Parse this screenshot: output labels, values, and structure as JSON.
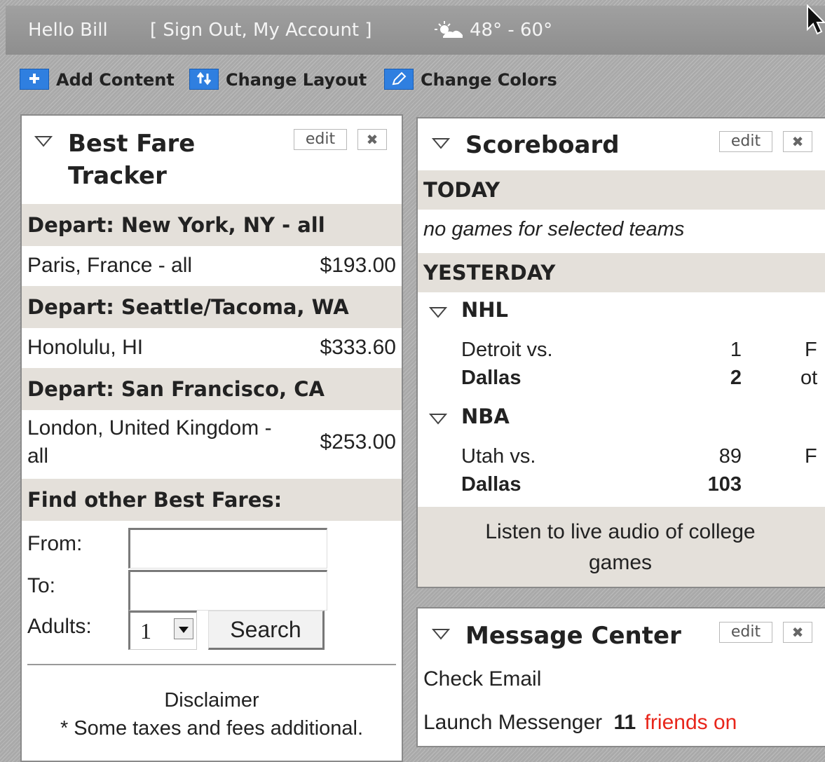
{
  "topbar": {
    "greeting": "Hello Bill",
    "account_links": "[ Sign Out, My Account ]",
    "weather": "48° - 60°"
  },
  "toolbar": {
    "add_content": "Add Content",
    "change_layout": "Change Layout",
    "change_colors": "Change Colors"
  },
  "fare_tracker": {
    "title_line1": "Best Fare",
    "title_line2": "Tracker",
    "edit_label": "edit",
    "close_label": "✖",
    "groups": [
      {
        "depart": "Depart: New York, NY - all",
        "dest": "Paris, France - all",
        "price": "$193.00"
      },
      {
        "depart": "Depart: Seattle/Tacoma, WA",
        "dest": "Honolulu, HI",
        "price": "$333.60"
      },
      {
        "depart": "Depart: San Francisco, CA",
        "dest_line1": "London, United Kingdom -",
        "dest_line2": "all",
        "price": "$253.00"
      }
    ],
    "find_heading": "Find other Best Fares:",
    "from_label": "From:",
    "to_label": "To:",
    "adults_label": "Adults:",
    "from_value": "",
    "to_value": "",
    "adults_value": "1",
    "search_label": "Search",
    "disclaimer_title": "Disclaimer",
    "disclaimer_text": "* Some taxes and fees additional."
  },
  "scoreboard": {
    "title": "Scoreboard",
    "edit_label": "edit",
    "close_label": "✖",
    "today_label": "TODAY",
    "today_note": "no games for selected teams",
    "yesterday_label": "YESTERDAY",
    "leagues": [
      {
        "name": "NHL",
        "team1": "Detroit vs.",
        "score1": "1",
        "status1": "F",
        "team2": "Dallas",
        "score2": "2",
        "status2": "ot"
      },
      {
        "name": "NBA",
        "team1": "Utah vs.",
        "score1": "89",
        "status1": "F",
        "team2": "Dallas",
        "score2": "103",
        "status2": ""
      }
    ],
    "audio_line1": "Listen to live audio of college",
    "audio_line2": "games"
  },
  "message_center": {
    "title": "Message Center",
    "edit_label": "edit",
    "close_label": "✖",
    "check_email": "Check Email",
    "launch_messenger": "Launch Messenger",
    "friends_count": "11",
    "friends_text": "friends on"
  },
  "colors": {
    "toolbar_icon": "#2f7fe0",
    "band": "#e4e0da",
    "friends_red": "#e8261b"
  }
}
